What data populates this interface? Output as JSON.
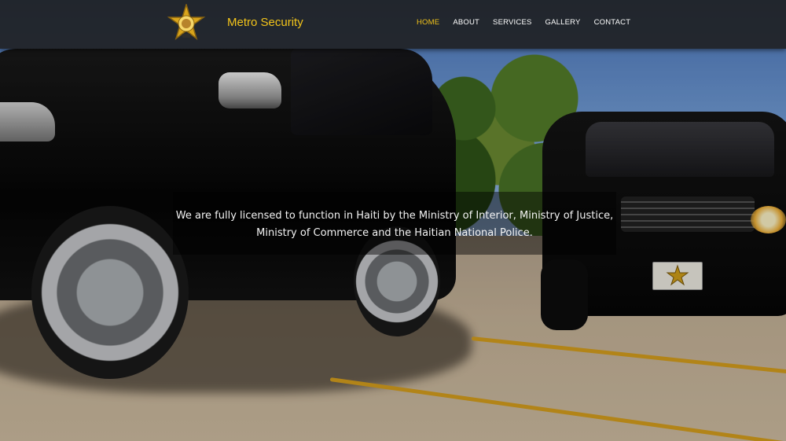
{
  "header": {
    "brand": "Metro Security",
    "logo_icon": "sheriff-star-badge-icon",
    "nav": [
      {
        "label": "HOME",
        "active": true
      },
      {
        "label": "ABOUT",
        "active": false
      },
      {
        "label": "SERVICES",
        "active": false
      },
      {
        "label": "GALLERY",
        "active": false
      },
      {
        "label": "CONTACT",
        "active": false
      }
    ]
  },
  "hero": {
    "caption_line1": "We are fully licensed to function in Haiti by the Ministry of Interior, Ministry of Justice,",
    "caption_line2": "Ministry of Commerce and the Haitian National Police."
  },
  "colors": {
    "accent": "#f3c41a",
    "header_bg": "#1e1e1e",
    "caption_text": "#f4f4f4"
  }
}
